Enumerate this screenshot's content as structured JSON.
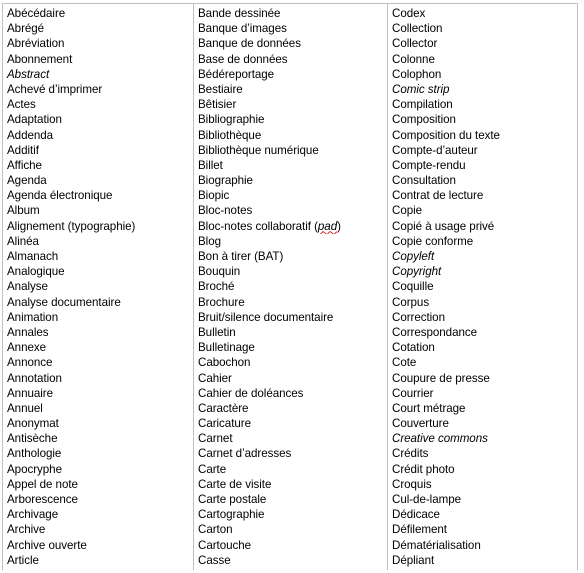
{
  "document": {
    "type": "glossary-table",
    "language": "fr",
    "column_count": 3,
    "border_color": "#bfbfbf",
    "text_color": "#000000",
    "background_color": "#ffffff",
    "spellcheck_underline_color": "#e02020"
  },
  "columns": [
    {
      "name": "column-a",
      "terms": [
        {
          "text": "Abécédaire",
          "style": "normal"
        },
        {
          "text": "Abrégé",
          "style": "normal"
        },
        {
          "text": "Abréviation",
          "style": "normal"
        },
        {
          "text": "Abonnement",
          "style": "normal"
        },
        {
          "text": "Abstract",
          "style": "italic"
        },
        {
          "text": "Achevé d’imprimer",
          "style": "normal"
        },
        {
          "text": "Actes",
          "style": "normal"
        },
        {
          "text": "Adaptation",
          "style": "normal"
        },
        {
          "text": "Addenda",
          "style": "normal"
        },
        {
          "text": "Additif",
          "style": "normal"
        },
        {
          "text": "Affiche",
          "style": "normal"
        },
        {
          "text": "Agenda",
          "style": "normal"
        },
        {
          "text": "Agenda électronique",
          "style": "normal"
        },
        {
          "text": "Album",
          "style": "normal"
        },
        {
          "text": "Alignement (typographie)",
          "style": "normal"
        },
        {
          "text": "Alinéa",
          "style": "normal"
        },
        {
          "text": "Almanach",
          "style": "normal"
        },
        {
          "text": "Analogique",
          "style": "normal"
        },
        {
          "text": "Analyse",
          "style": "normal"
        },
        {
          "text": "Analyse documentaire",
          "style": "normal"
        },
        {
          "text": "Animation",
          "style": "normal"
        },
        {
          "text": "Annales",
          "style": "normal"
        },
        {
          "text": "Annexe",
          "style": "normal"
        },
        {
          "text": "Annonce",
          "style": "normal"
        },
        {
          "text": "Annotation",
          "style": "normal"
        },
        {
          "text": "Annuaire",
          "style": "normal"
        },
        {
          "text": "Annuel",
          "style": "normal"
        },
        {
          "text": "Anonymat",
          "style": "normal"
        },
        {
          "text": "Antisèche",
          "style": "normal"
        },
        {
          "text": "Anthologie",
          "style": "normal"
        },
        {
          "text": "Apocryphe",
          "style": "normal"
        },
        {
          "text": "Appel de note",
          "style": "normal"
        },
        {
          "text": "Arborescence",
          "style": "normal"
        },
        {
          "text": "Archivage",
          "style": "normal"
        },
        {
          "text": "Archive",
          "style": "normal"
        },
        {
          "text": "Archive ouverte",
          "style": "normal"
        },
        {
          "text": "Article",
          "style": "normal"
        }
      ]
    },
    {
      "name": "column-b",
      "terms": [
        {
          "text": "Bande dessinée",
          "style": "normal"
        },
        {
          "text": "Banque d’images",
          "style": "normal"
        },
        {
          "text": "Banque de données",
          "style": "normal"
        },
        {
          "text": "Base de données",
          "style": "normal"
        },
        {
          "text": "Bédéreportage",
          "style": "normal"
        },
        {
          "text": "Bestiaire",
          "style": "normal"
        },
        {
          "text": "Bêtisier",
          "style": "normal"
        },
        {
          "text": "Bibliographie",
          "style": "normal"
        },
        {
          "text": "Bibliothèque",
          "style": "normal"
        },
        {
          "text": "Bibliothèque numérique",
          "style": "normal"
        },
        {
          "text": "Billet",
          "style": "normal"
        },
        {
          "text": "Biographie",
          "style": "normal"
        },
        {
          "text": "Biopic",
          "style": "normal"
        },
        {
          "text": "Bloc-notes",
          "style": "normal"
        },
        {
          "text": "Bloc-notes collaboratif (",
          "style": "normal",
          "suffix_misspelled": "pad",
          "suffix_after": ")"
        },
        {
          "text": "Blog",
          "style": "normal"
        },
        {
          "text": "Bon à tirer (BAT)",
          "style": "normal"
        },
        {
          "text": "Bouquin",
          "style": "normal"
        },
        {
          "text": "Broché",
          "style": "normal"
        },
        {
          "text": "Brochure",
          "style": "normal"
        },
        {
          "text": "Bruit/silence documentaire",
          "style": "normal"
        },
        {
          "text": "Bulletin",
          "style": "normal"
        },
        {
          "text": "Bulletinage",
          "style": "normal"
        },
        {
          "text": "Cabochon",
          "style": "normal"
        },
        {
          "text": "Cahier",
          "style": "normal"
        },
        {
          "text": "Cahier de doléances",
          "style": "normal"
        },
        {
          "text": "Caractère",
          "style": "normal"
        },
        {
          "text": "Caricature",
          "style": "normal"
        },
        {
          "text": "Carnet",
          "style": "normal"
        },
        {
          "text": "Carnet d’adresses",
          "style": "normal"
        },
        {
          "text": "Carte",
          "style": "normal"
        },
        {
          "text": "Carte de visite",
          "style": "normal"
        },
        {
          "text": "Carte postale",
          "style": "normal"
        },
        {
          "text": "Cartographie",
          "style": "normal"
        },
        {
          "text": "Carton",
          "style": "normal"
        },
        {
          "text": "Cartouche",
          "style": "normal"
        },
        {
          "text": "Casse",
          "style": "normal"
        }
      ]
    },
    {
      "name": "column-c",
      "terms": [
        {
          "text": "Codex",
          "style": "normal"
        },
        {
          "text": "Collection",
          "style": "normal"
        },
        {
          "text": "Collector",
          "style": "normal"
        },
        {
          "text": "Colonne",
          "style": "normal"
        },
        {
          "text": "Colophon",
          "style": "normal"
        },
        {
          "text": "Comic strip",
          "style": "italic"
        },
        {
          "text": "Compilation",
          "style": "normal"
        },
        {
          "text": "Composition",
          "style": "normal"
        },
        {
          "text": "Composition du texte",
          "style": "normal"
        },
        {
          "text": "Compte-d’auteur",
          "style": "normal"
        },
        {
          "text": "Compte-rendu",
          "style": "normal"
        },
        {
          "text": "Consultation",
          "style": "normal"
        },
        {
          "text": "Contrat de lecture",
          "style": "normal"
        },
        {
          "text": "Copie",
          "style": "normal"
        },
        {
          "text": "Copié à usage privé",
          "style": "normal"
        },
        {
          "text": "Copie conforme",
          "style": "normal"
        },
        {
          "text": "Copyleft",
          "style": "italic"
        },
        {
          "text": "Copyright",
          "style": "italic"
        },
        {
          "text": "Coquille",
          "style": "normal"
        },
        {
          "text": "Corpus",
          "style": "normal"
        },
        {
          "text": "Correction",
          "style": "normal"
        },
        {
          "text": "Correspondance",
          "style": "normal"
        },
        {
          "text": "Cotation",
          "style": "normal"
        },
        {
          "text": "Cote",
          "style": "normal"
        },
        {
          "text": "Coupure de presse",
          "style": "normal"
        },
        {
          "text": "Courrier",
          "style": "normal"
        },
        {
          "text": "Court métrage",
          "style": "normal"
        },
        {
          "text": "Couverture",
          "style": "normal"
        },
        {
          "text": "Creative commons",
          "style": "italic"
        },
        {
          "text": "Crédits",
          "style": "normal"
        },
        {
          "text": "Crédit photo",
          "style": "normal"
        },
        {
          "text": "Croquis",
          "style": "normal"
        },
        {
          "text": "Cul-de-lampe",
          "style": "normal"
        },
        {
          "text": "Dédicace",
          "style": "normal"
        },
        {
          "text": "Défilement",
          "style": "normal"
        },
        {
          "text": "Dématérialisation",
          "style": "normal"
        },
        {
          "text": "Dépliant",
          "style": "normal"
        }
      ]
    }
  ]
}
